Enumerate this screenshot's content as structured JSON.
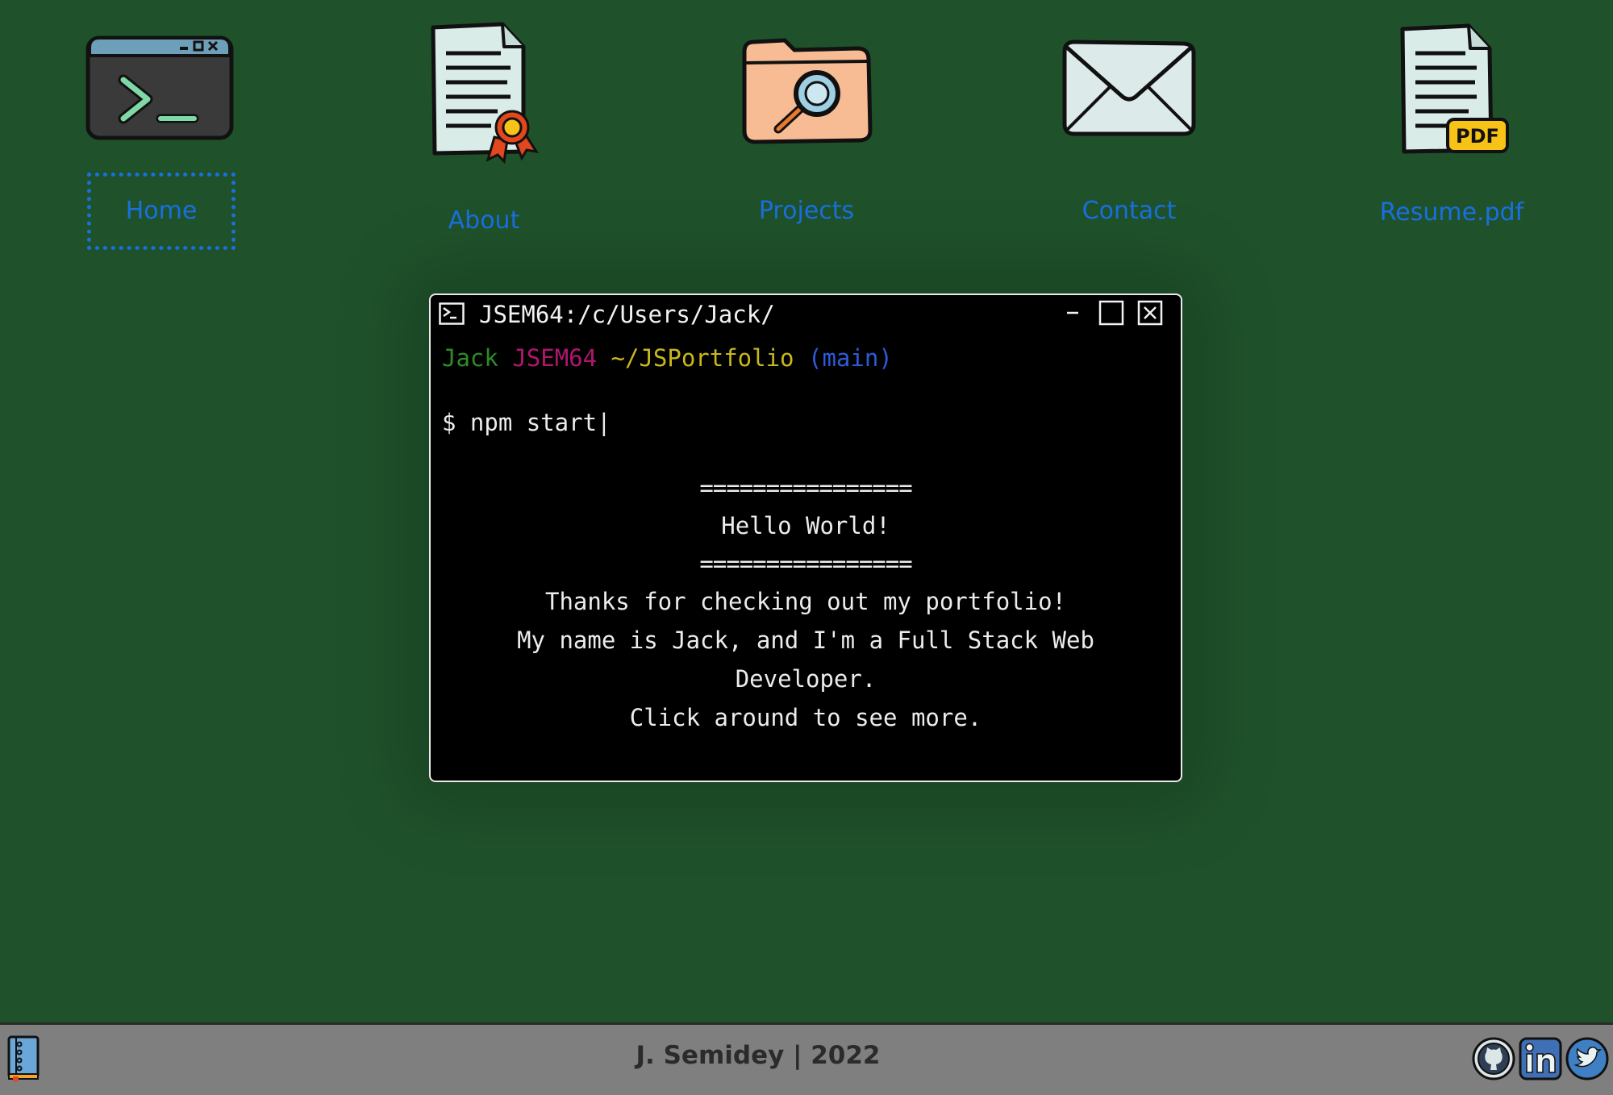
{
  "desktop": {
    "icons": [
      {
        "label": "Home",
        "icon": "terminal-icon",
        "selected": true
      },
      {
        "label": "About",
        "icon": "certificate-document-icon",
        "selected": false
      },
      {
        "label": "Projects",
        "icon": "folder-search-icon",
        "selected": false
      },
      {
        "label": "Contact",
        "icon": "envelope-icon",
        "selected": false
      },
      {
        "label": "Resume.pdf",
        "icon": "pdf-document-icon",
        "selected": false
      }
    ]
  },
  "terminal": {
    "title": "JSEM64:/c/Users/Jack/",
    "prompt": {
      "user": "Jack",
      "host": "JSEM64",
      "path": "~/JSPortfolio",
      "branch": "(main)"
    },
    "command": "$ npm start",
    "cursor": "|",
    "output": {
      "rule": "================",
      "greeting": "Hello World!",
      "lines": [
        "Thanks for checking out my portfolio!",
        "My name is Jack, and I'm a Full Stack Web Developer.",
        "Click around to see more."
      ]
    },
    "controls": {
      "minimize": "–"
    }
  },
  "footer": {
    "credit": "J. Semidey | 2022",
    "social": [
      "github-icon",
      "linkedin-icon",
      "twitter-icon"
    ]
  },
  "colors": {
    "desktop_bg": "#1f522b",
    "link": "#1a6fe0",
    "footer_bg": "#7f7f7f",
    "prompt_user": "#2e8b27",
    "prompt_host": "#b0166e",
    "prompt_path": "#c8b81c",
    "prompt_branch": "#2d5bd8"
  }
}
